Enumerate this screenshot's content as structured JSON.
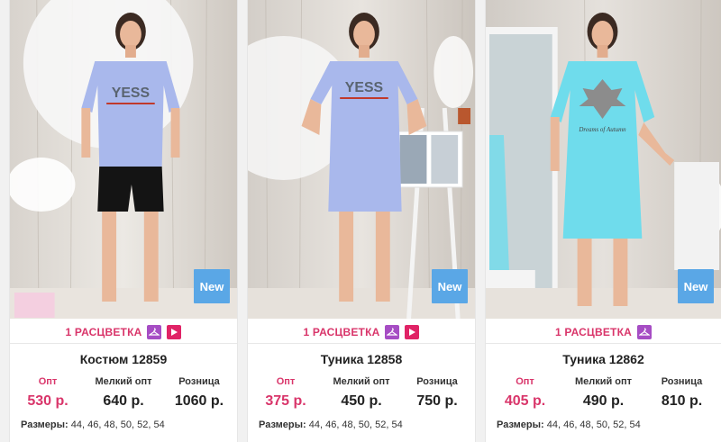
{
  "products": [
    {
      "title": "Костюм 12859",
      "badge": "New",
      "colors_label": "1 РАСЦВЕТКА",
      "price_labels": [
        "Опт",
        "Мелкий опт",
        "Розница"
      ],
      "prices": [
        "530 р.",
        "640 р.",
        "1060 р."
      ],
      "sizes_label": "Размеры:",
      "sizes": "44, 46, 48, 50, 52, 54",
      "print_text": "YESS",
      "garment_color": "#a9b8ec"
    },
    {
      "title": "Туника 12858",
      "badge": "New",
      "colors_label": "1 РАСЦВЕТКА",
      "price_labels": [
        "Опт",
        "Мелкий опт",
        "Розница"
      ],
      "prices": [
        "375 р.",
        "450 р.",
        "750 р."
      ],
      "sizes_label": "Размеры:",
      "sizes": "44, 46, 48, 50, 52, 54",
      "print_text": "YESS",
      "garment_color": "#a9b8ec"
    },
    {
      "title": "Туника 12862",
      "badge": "New",
      "colors_label": "1 РАСЦВЕТКА",
      "price_labels": [
        "Опт",
        "Мелкий опт",
        "Розница"
      ],
      "prices": [
        "405 р.",
        "490 р.",
        "810 р."
      ],
      "sizes_label": "Размеры:",
      "sizes": "44, 46, 48, 50, 52, 54",
      "print_text": "Dreams of Autumn",
      "garment_color": "#6fdcec"
    }
  ],
  "colors": {
    "accent_pink": "#d9356a",
    "badge_blue": "#5aa7e6",
    "hanger_purple": "#a64dc4",
    "play_red": "#e02366"
  },
  "icons": [
    "hanger-icon",
    "play-icon"
  ]
}
